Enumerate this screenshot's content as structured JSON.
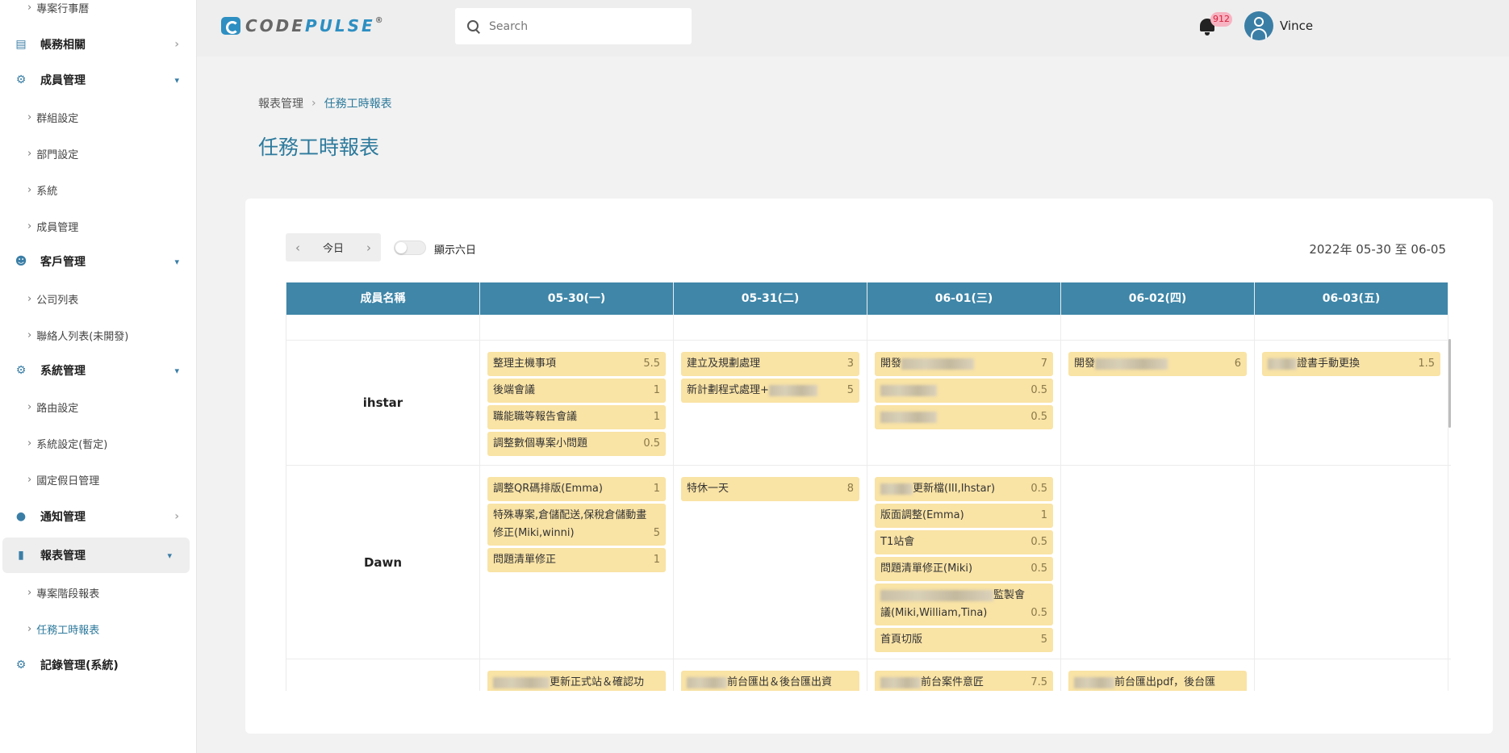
{
  "sidebar": {
    "items": [
      {
        "type": "sub",
        "label": "專案行事曆",
        "top": 0
      },
      {
        "type": "group",
        "label": "帳務相關",
        "icon": "building-icon",
        "chev": "right"
      },
      {
        "type": "group",
        "label": "成員管理",
        "icon": "user-gear-icon",
        "chev": "down"
      },
      {
        "type": "sub",
        "label": "群組設定"
      },
      {
        "type": "sub",
        "label": "部門設定"
      },
      {
        "type": "sub",
        "label": "系統"
      },
      {
        "type": "sub",
        "label": "成員管理"
      },
      {
        "type": "group",
        "label": "客戶管理",
        "icon": "users-icon",
        "chev": "down"
      },
      {
        "type": "sub",
        "label": "公司列表"
      },
      {
        "type": "sub",
        "label": "聯絡人列表(未開發)"
      },
      {
        "type": "group",
        "label": "系統管理",
        "icon": "gear-icon",
        "chev": "down"
      },
      {
        "type": "sub",
        "label": "路由設定"
      },
      {
        "type": "sub",
        "label": "系統設定(暫定)"
      },
      {
        "type": "sub",
        "label": "國定假日管理"
      },
      {
        "type": "group",
        "label": "通知管理",
        "icon": "bulb-icon",
        "chev": "right"
      },
      {
        "type": "group",
        "label": "報表管理",
        "icon": "bar-chart-icon",
        "chev": "down",
        "active": true
      },
      {
        "type": "sub",
        "label": "專案階段報表"
      },
      {
        "type": "sub",
        "label": "任務工時報表",
        "active": true
      },
      {
        "type": "group",
        "label": "記錄管理(系統)",
        "icon": "gears-icon",
        "chev": "none"
      }
    ]
  },
  "header": {
    "logo_text_a": "CODE",
    "logo_text_b": "PULSE",
    "logo_reg": "®",
    "search_placeholder": "Search",
    "notification_count": "912",
    "username": "Vince"
  },
  "breadcrumb": {
    "parent": "報表管理",
    "current": "任務工時報表"
  },
  "page_title": "任務工時報表",
  "toolbar": {
    "prev": "‹",
    "today": "今日",
    "next": "›",
    "toggle_label": "顯示六日",
    "toggle_on": false,
    "date_range": "2022年 05-30 至 06-05"
  },
  "table": {
    "headers": [
      "成員名稱",
      "05-30(一)",
      "05-31(二)",
      "06-01(三)",
      "06-02(四)",
      "06-03(五)"
    ],
    "rows": [
      {
        "member": "",
        "days": [
          [],
          [],
          [],
          [],
          []
        ],
        "blank": true
      },
      {
        "member": "ihstar",
        "days": [
          [
            {
              "text": "整理主機事項",
              "hours": "5.5"
            },
            {
              "text": "後端會議",
              "hours": "1"
            },
            {
              "text": "職能職等報告會議",
              "hours": "1"
            },
            {
              "text": "調整數個專案小問題",
              "hours": "0.5"
            }
          ],
          [
            {
              "text": "建立及規劃處理",
              "hours": "3"
            },
            {
              "text": "新計劃程式處理+",
              "blur": 60,
              "hours": "5"
            }
          ],
          [
            {
              "text": "開發",
              "blur": 90,
              "hours": "7"
            },
            {
              "text": "",
              "blur": 70,
              "hours": "0.5"
            },
            {
              "text": "",
              "blur": 70,
              "hours": "0.5"
            }
          ],
          [
            {
              "text": "開發",
              "blur": 90,
              "hours": "6"
            }
          ],
          [
            {
              "prefix_blur": 36,
              "text": "證書手動更換",
              "hours": "1.5"
            }
          ]
        ]
      },
      {
        "member": "Dawn",
        "days": [
          [
            {
              "text": "調整QR碼排版(Emma)",
              "hours": "1"
            },
            {
              "text": "特殊專案,倉儲配送,保稅倉儲動畫修正(Miki,winni)",
              "hours": "5"
            },
            {
              "text": "問題清單修正",
              "hours": "1"
            }
          ],
          [
            {
              "text": "特休一天",
              "hours": "8"
            }
          ],
          [
            {
              "prefix_blur": 40,
              "text": "更新檔(III,Ihstar)",
              "hours": "0.5"
            },
            {
              "text": "版面調整(Emma)",
              "hours": "1"
            },
            {
              "text": "T1站會",
              "hours": "0.5"
            },
            {
              "text": "問題清單修正(Miki)",
              "hours": "0.5"
            },
            {
              "prefix_blur": 140,
              "text": "監製會議(Miki,William,Tina)",
              "hours": "0.5"
            },
            {
              "text": "首頁切版",
              "hours": "5"
            }
          ],
          [],
          []
        ]
      },
      {
        "member": "",
        "days": [
          [
            {
              "prefix_blur": 70,
              "text": "更新正式站＆確認功",
              "hours": ""
            }
          ],
          [
            {
              "prefix_blur": 50,
              "text": "前台匯出＆後台匯出資",
              "hours": ""
            }
          ],
          [
            {
              "prefix_blur": 50,
              "text": "前台案件意匠",
              "hours": "7.5"
            }
          ],
          [
            {
              "prefix_blur": 50,
              "text": "前台匯出pdf，後台匯",
              "hours": ""
            }
          ],
          []
        ]
      }
    ]
  },
  "colors": {
    "accent": "#3f86a8",
    "task_bg": "#f9e3a5",
    "badge_bg": "#f7b3c1",
    "badge_text": "#d6223e"
  }
}
